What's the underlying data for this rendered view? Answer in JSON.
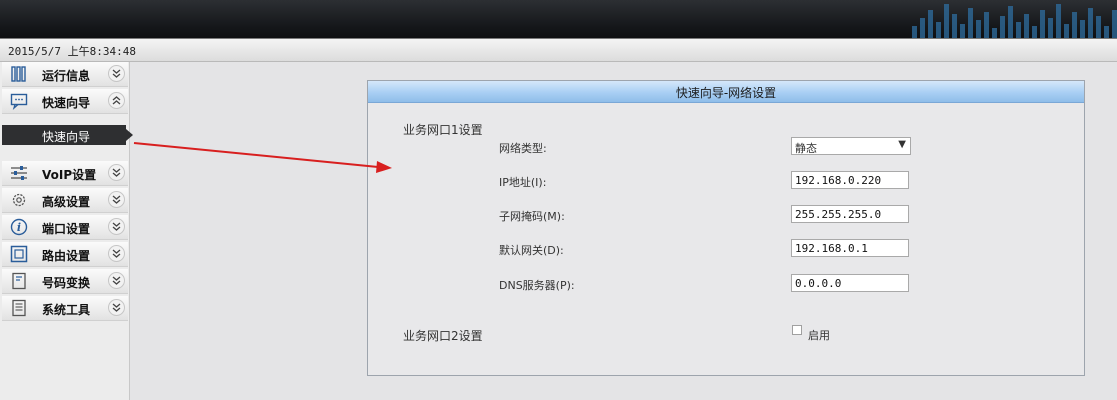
{
  "header": {
    "datetime": "2015/5/7 上午8:34:48"
  },
  "sidebar": {
    "items": [
      {
        "label": "运行信息",
        "icon": "books-icon",
        "chevron": "expand"
      },
      {
        "label": "快速向导",
        "icon": "monitor-chat-icon",
        "chevron": "collapse"
      },
      {
        "label": "VoIP设置",
        "icon": "sliders-icon",
        "chevron": "expand"
      },
      {
        "label": "高级设置",
        "icon": "gear-icon",
        "chevron": "expand"
      },
      {
        "label": "端口设置",
        "icon": "info-icon",
        "chevron": "expand"
      },
      {
        "label": "路由设置",
        "icon": "square-icon",
        "chevron": "expand"
      },
      {
        "label": "号码变换",
        "icon": "document-edit-icon",
        "chevron": "expand"
      },
      {
        "label": "系统工具",
        "icon": "list-icon",
        "chevron": "expand"
      }
    ],
    "active_subitem": "快速向导"
  },
  "panel": {
    "title": "快速向导-网络设置",
    "section1": {
      "label": "业务网口1设置",
      "network_type_label": "网络类型:",
      "network_type_value": "静态",
      "ip_label": "IP地址(I):",
      "ip_value": "192.168.0.220",
      "mask_label": "子网掩码(M):",
      "mask_value": "255.255.255.0",
      "gateway_label": "默认网关(D):",
      "gateway_value": "192.168.0.1",
      "dns_label": "DNS服务器(P):",
      "dns_value": "0.0.0.0"
    },
    "section2": {
      "label": "业务网口2设置",
      "enable_label": "启用"
    }
  },
  "colors": {
    "annotation_arrow": "#d81f1f",
    "panel_header": "#a9cff4",
    "active_nav": "#2e2f31"
  }
}
